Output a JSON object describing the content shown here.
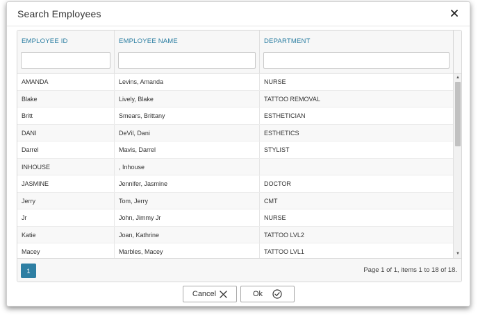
{
  "dialog": {
    "title": "Search Employees",
    "close_icon": "close-icon"
  },
  "columns": [
    {
      "label": "EMPLOYEE ID",
      "filter_value": ""
    },
    {
      "label": "EMPLOYEE NAME",
      "filter_value": ""
    },
    {
      "label": "DEPARTMENT",
      "filter_value": ""
    }
  ],
  "rows": [
    {
      "id": "AMANDA",
      "name": "Levins, Amanda",
      "department": "NURSE"
    },
    {
      "id": "Blake",
      "name": "Lively, Blake",
      "department": "TATTOO REMOVAL"
    },
    {
      "id": "Britt",
      "name": "Smears, Brittany",
      "department": "ESTHETICIAN"
    },
    {
      "id": "DANI",
      "name": "DeVil, Dani",
      "department": "ESTHETICS"
    },
    {
      "id": "Darrel",
      "name": "Mavis, Darrel",
      "department": "STYLIST"
    },
    {
      "id": "INHOUSE",
      "name": ", Inhouse",
      "department": ""
    },
    {
      "id": "JASMINE",
      "name": "Jennifer, Jasmine",
      "department": "DOCTOR"
    },
    {
      "id": "Jerry",
      "name": "Tom, Jerry",
      "department": "CMT"
    },
    {
      "id": "Jr",
      "name": "John, Jimmy Jr",
      "department": "NURSE"
    },
    {
      "id": "Katie",
      "name": "Joan, Kathrine",
      "department": "TATTOO LVL2"
    },
    {
      "id": "Macey",
      "name": "Marbles, Macey",
      "department": "TATTOO LVL1"
    }
  ],
  "pager": {
    "current_page": "1",
    "info": "Page 1 of 1, items 1 to 18 of 18."
  },
  "footer": {
    "cancel_label": "Cancel",
    "ok_label": "Ok"
  },
  "colors": {
    "accent": "#2e7fa3",
    "header_text": "#2a7da1"
  }
}
